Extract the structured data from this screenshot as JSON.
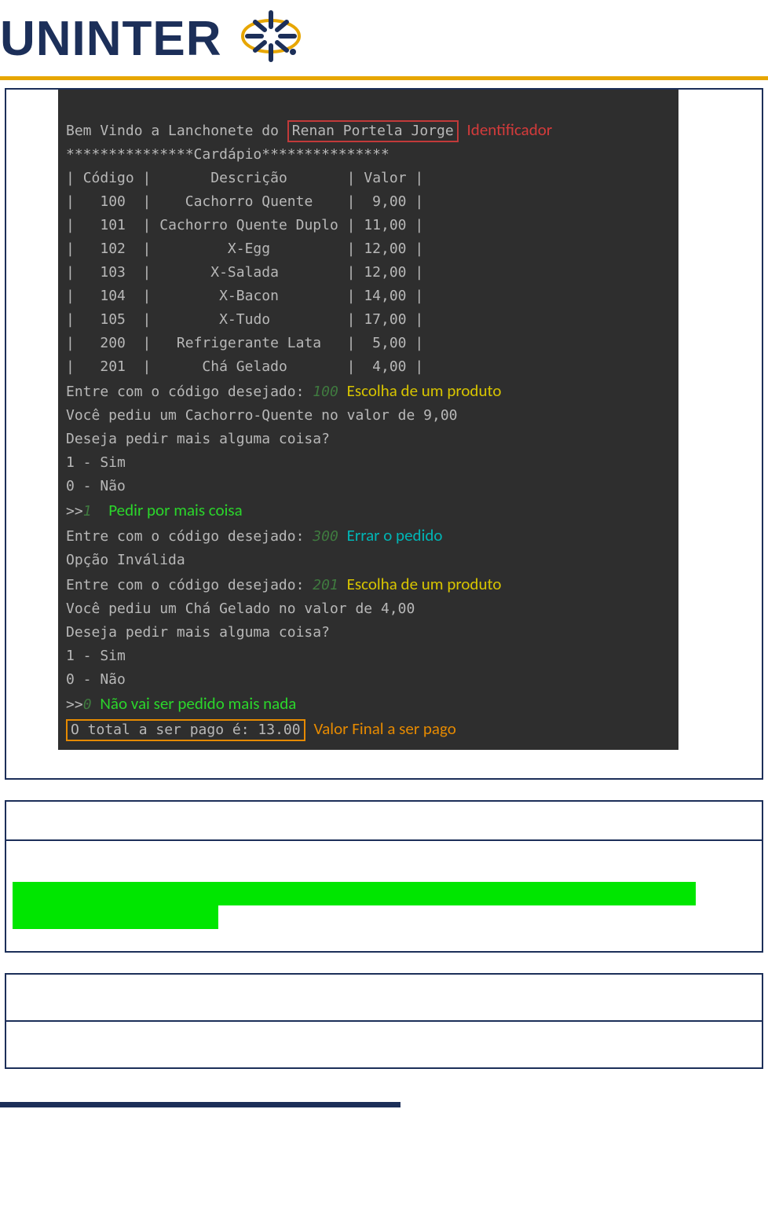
{
  "brand": {
    "name": "UNINTER"
  },
  "terminal": {
    "welcome_prefix": "Bem Vindo a Lanchonete do ",
    "identifier_name": "Renan Portela Jorge",
    "annot_identifier": "Identificador",
    "menu_title": "***************Cardápio***************",
    "header": {
      "codigo": "Código",
      "descricao": "Descrição",
      "valor": "Valor"
    },
    "items": [
      {
        "code": "100",
        "desc": "Cachorro Quente",
        "price": "9,00"
      },
      {
        "code": "101",
        "desc": "Cachorro Quente Duplo",
        "price": "11,00"
      },
      {
        "code": "102",
        "desc": "X-Egg",
        "price": "12,00"
      },
      {
        "code": "103",
        "desc": "X-Salada",
        "price": "12,00"
      },
      {
        "code": "104",
        "desc": "X-Bacon",
        "price": "14,00"
      },
      {
        "code": "105",
        "desc": "X-Tudo",
        "price": "17,00"
      },
      {
        "code": "200",
        "desc": "Refrigerante Lata",
        "price": "5,00"
      },
      {
        "code": "201",
        "desc": "Chá Gelado",
        "price": "4,00"
      }
    ],
    "prompt_code": "Entre com o código desejado: ",
    "input_100": "100",
    "annot_pick1": "Escolha de um produto",
    "echo_100": "Você pediu um Cachorro-Quente no valor de 9,00",
    "ask_more": "Deseja pedir mais alguma coisa?",
    "opt_yes": "1 - Sim",
    "opt_no": "0 - Não",
    "prompt_inline": ">>",
    "input_1": "1",
    "annot_more": "Pedir por mais coisa",
    "input_300": "300",
    "annot_wrong": "Errar o pedido",
    "invalid": "Opção Inválida",
    "input_201": "201",
    "annot_pick2": "Escolha de um produto",
    "echo_201": "Você pediu um Chá Gelado no valor de 4,00",
    "input_0": "0",
    "annot_nomore": "Não vai ser pedido mais nada",
    "total_line": "O total a ser pago é: 13.00",
    "annot_total": "Valor Final a ser pago"
  }
}
